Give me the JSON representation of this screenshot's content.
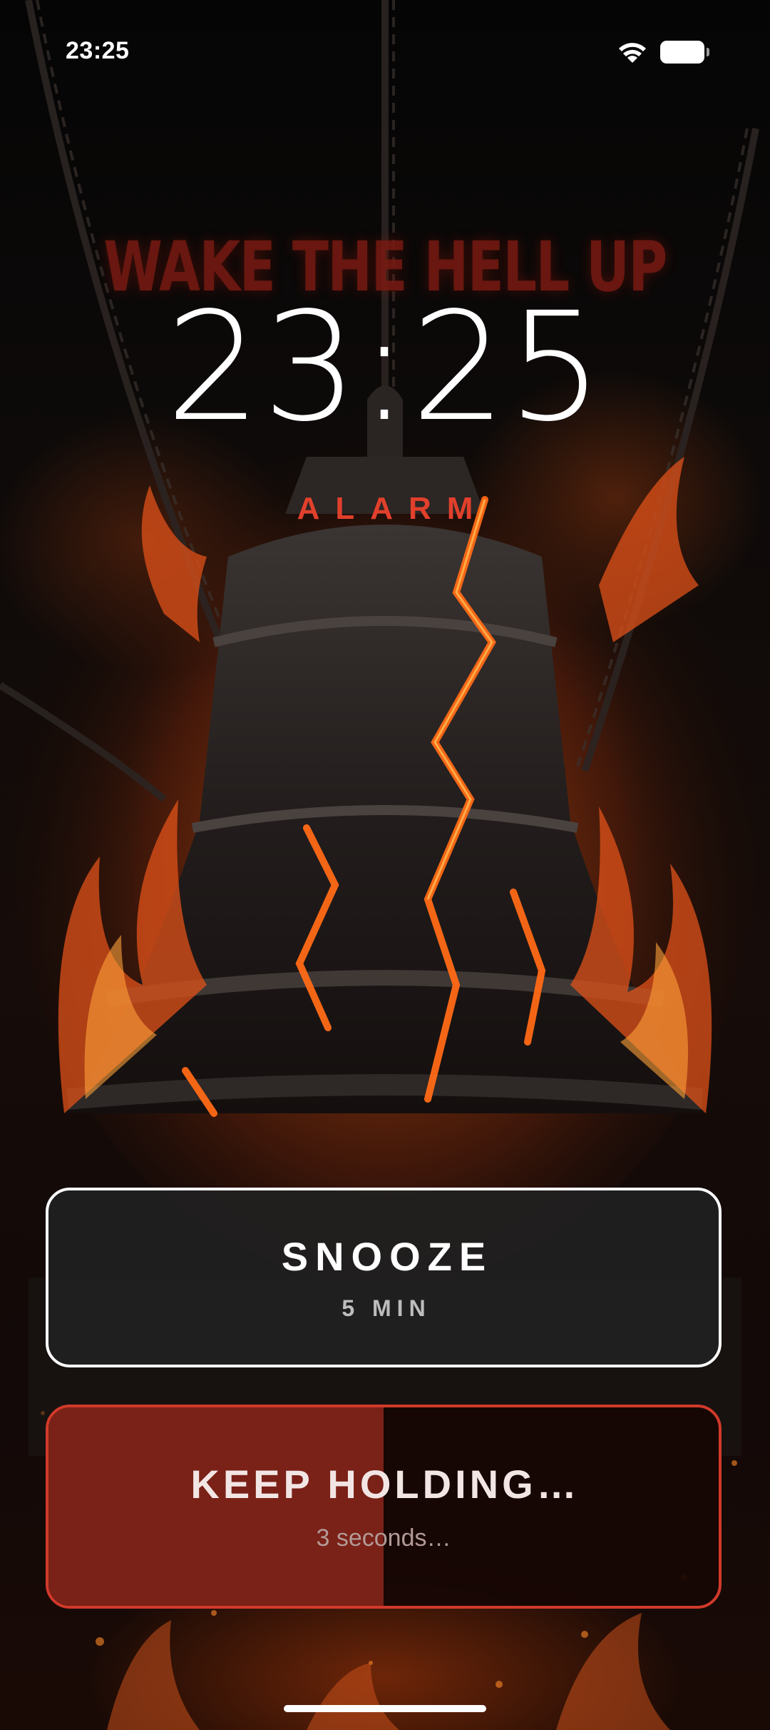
{
  "status_bar": {
    "time": "23:25",
    "wifi_icon": "wifi-icon",
    "battery_icon": "battery-icon",
    "battery_level": 0.9
  },
  "alarm": {
    "headline": "WAKE THE HELL UP",
    "time": "23:25",
    "label": "ALARM"
  },
  "snooze": {
    "title": "SNOOZE",
    "duration": "5 MIN"
  },
  "dismiss": {
    "title": "KEEP HOLDING…",
    "subtitle": "3 seconds…",
    "progress": 0.5
  },
  "colors": {
    "accent": "#e2402c",
    "hold_border": "#d13a2a",
    "hold_fill": "#7a2118",
    "headline": "#7a1a12"
  }
}
